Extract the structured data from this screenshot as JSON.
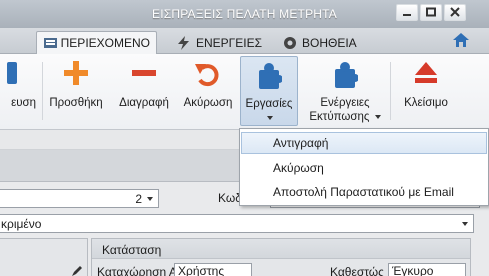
{
  "window": {
    "title": "ΕΙΣΠΡΑΞΕΙΣ ΠΕΛΑΤΗ ΜΕΤΡΗΤΑ"
  },
  "tabs": [
    {
      "label": "ΠΕΡΙΕΧΟΜΕΝΟ",
      "active": true
    },
    {
      "label": "ΕΝΕΡΓΕΙΕΣ"
    },
    {
      "label": "ΒΟΗΘΕΙΑ"
    }
  ],
  "ribbon": {
    "partial_label": "ευση",
    "add": "Προσθήκη",
    "delete": "Διαγραφή",
    "cancel": "Ακύρωση",
    "tools": "Εργασίες",
    "print_actions_line1": "Ενέργειες",
    "print_actions_line2": "Εκτύπωσης",
    "close": "Κλείσιμο"
  },
  "dropdown_menu": {
    "items": [
      {
        "label": "Αντιγραφή",
        "highlighted": true
      },
      {
        "label": "Ακύρωση"
      },
      {
        "label": "Αποστολή Παραστατικού με Email"
      }
    ]
  },
  "form": {
    "number_value": "2",
    "code_label": "Κωδ",
    "type_value": "κριμένο",
    "status_header": "Κατάσταση",
    "entry_from_label": "Καταχώρηση Από",
    "entry_from_value": "Χρήστης",
    "state_label": "Καθεστώς",
    "state_value": "Έγκυρο"
  },
  "colors": {
    "accent_orange": "#f08a2a",
    "delete_red": "#d9462e",
    "tools_blue": "#2f6fb5",
    "close_red": "#d63a2a"
  }
}
